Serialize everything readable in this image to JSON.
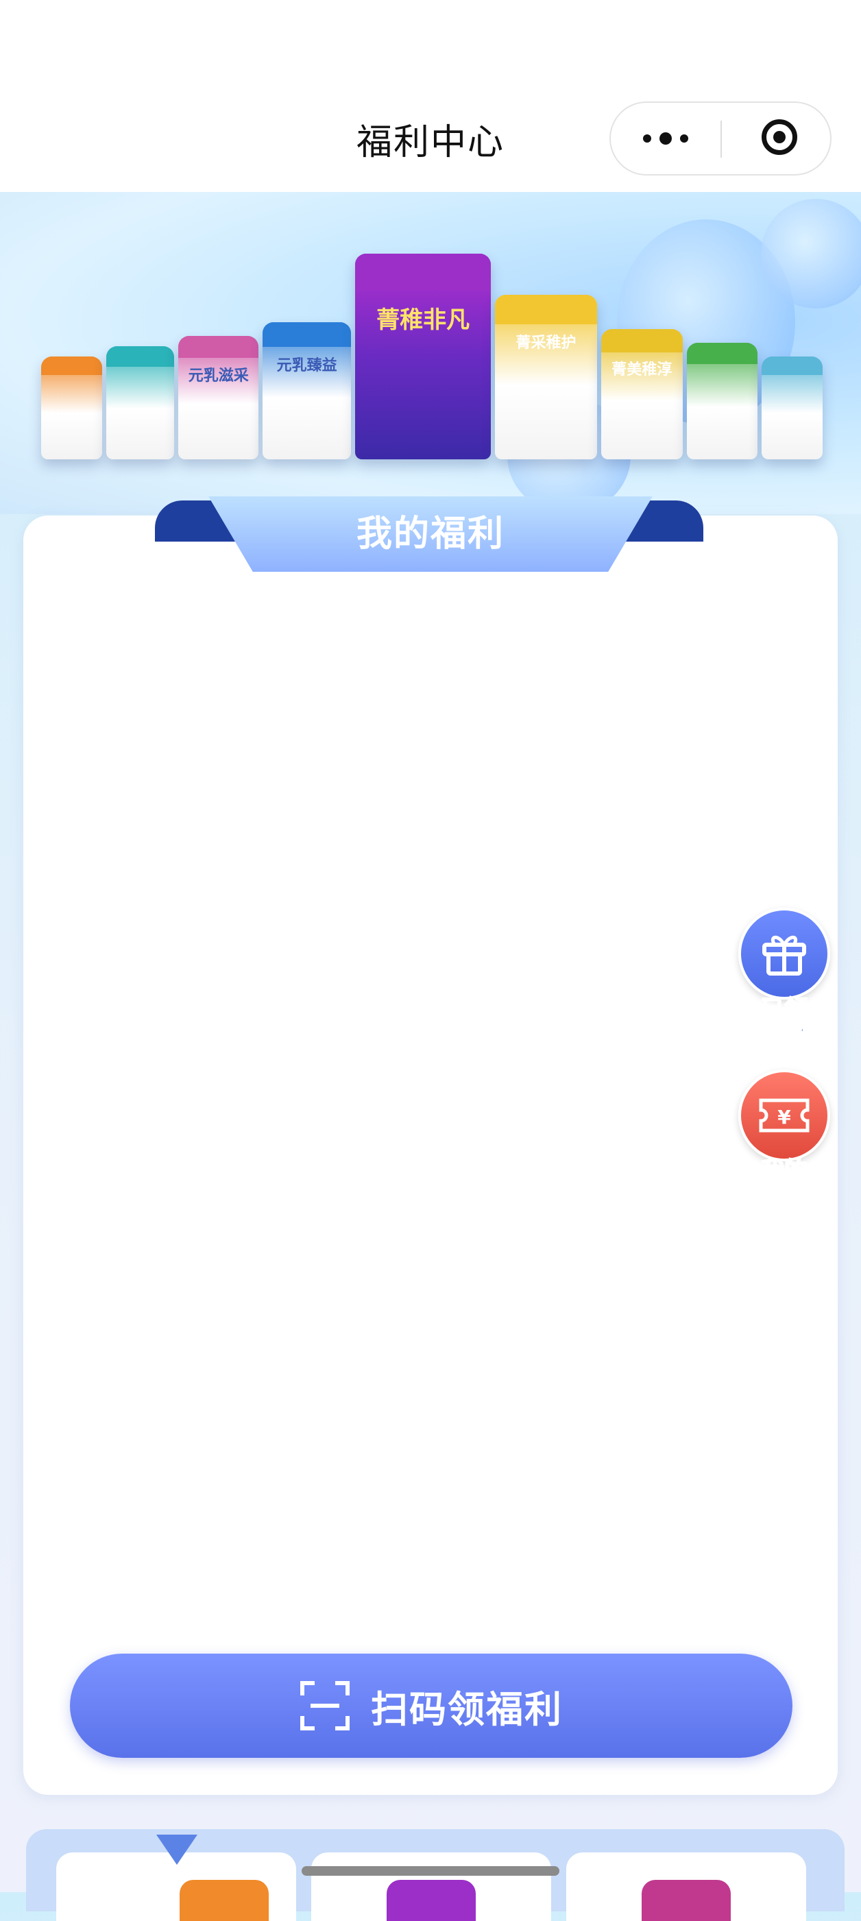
{
  "nav": {
    "title": "福利中心",
    "more_icon": "more-dots-icon",
    "close_icon": "target-circle-icon"
  },
  "banner": {
    "cans": [
      {
        "label": "",
        "color": "#f08a2a"
      },
      {
        "label": "",
        "color": "#2ab3b8"
      },
      {
        "label": "元乳滋采",
        "color": "#d05ba7"
      },
      {
        "label": "元乳臻益",
        "color": "#2a7ed8"
      },
      {
        "label": "菁稚非凡",
        "color": "#9b2fc8"
      },
      {
        "label": "菁采稚护",
        "color": "#f2c630"
      },
      {
        "label": "菁美稚淳",
        "color": "#e9c22a"
      },
      {
        "label": "",
        "color": "#47b04a"
      },
      {
        "label": "",
        "color": "#5ab7d8"
      }
    ]
  },
  "section": {
    "title": "我的福利"
  },
  "side": {
    "gift_label_1": "已领",
    "gift_label_2": "取福利",
    "coupon_label_1": "我的",
    "coupon_label_2": "优惠券"
  },
  "scan": {
    "label": "扫码领福利",
    "icon": "scan-icon"
  },
  "colors": {
    "accent": "#5a72ea",
    "coupon": "#e14a3c",
    "gift": "#4b6ae6"
  }
}
